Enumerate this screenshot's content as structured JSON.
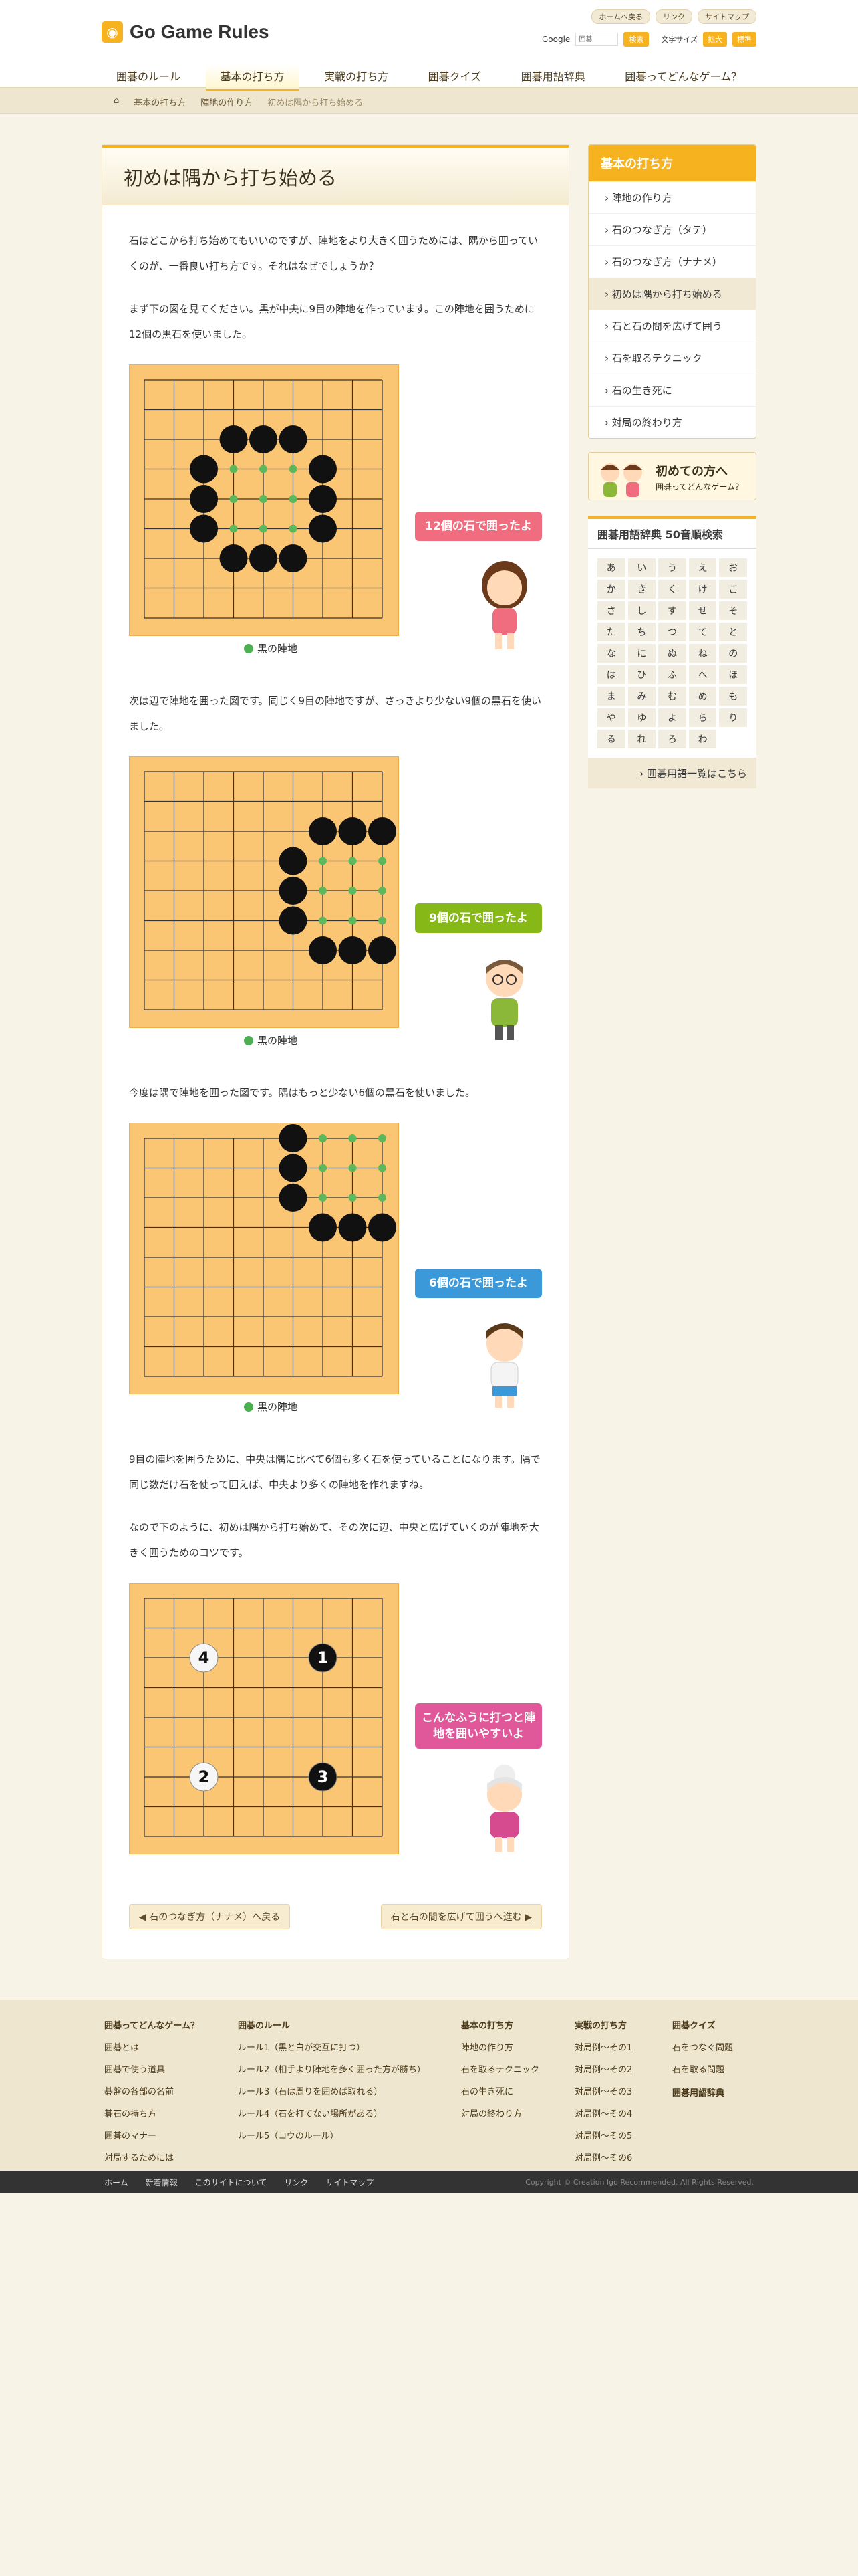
{
  "header": {
    "logo_text": "Go Game Rules",
    "util": [
      "ホームへ戻る",
      "リンク",
      "サイトマップ"
    ],
    "search_label": "Google",
    "search_placeholder": "囲碁",
    "search_button": "検索",
    "font_size_label": "文字サイズ",
    "font_large": "拡大",
    "font_std": "標準"
  },
  "nav": [
    "囲碁のルール",
    "基本の打ち方",
    "実戦の打ち方",
    "囲碁クイズ",
    "囲碁用語辞典",
    "囲碁ってどんなゲーム？"
  ],
  "breadcrumb": [
    "基本の打ち方",
    "陣地の作り方",
    "初めは隅から打ち始める"
  ],
  "main": {
    "title": "初めは隅から打ち始める",
    "p1": "石はどこから打ち始めてもいいのですが、陣地をより大きく囲うためには、隅から囲っていくのが、一番良い打ち方です。それはなぜでしょうか？",
    "p2": "まず下の図を見てください。黒が中央に9目の陣地を作っています。この陣地を囲うために12個の黒石を使いました。",
    "caption": "黒の陣地",
    "bubble1": "12個の石で囲ったよ",
    "p3": "次は辺で陣地を囲った図です。同じく9目の陣地ですが、さっきより少ない9個の黒石を使いました。",
    "bubble2": "9個の石で囲ったよ",
    "p4": "今度は隅で陣地を囲った図です。隅はもっと少ない6個の黒石を使いました。",
    "bubble3": "6個の石で囲ったよ",
    "p5": "9目の陣地を囲うために、中央は隅に比べて6個も多く石を使っていることになります。隅で同じ数だけ石を使って囲えば、中央より多くの陣地を作れますね。",
    "p6": "なので下のように、初めは隅から打ち始めて、その次に辺、中央と広げていくのが陣地を大きく囲うためのコツです。",
    "bubble4": "こんなふうに打つと陣地を囲いやすいよ",
    "prev": "石のつなぎ方（ナナメ）へ戻る",
    "next": "石と石の間を広げて囲うへ進む"
  },
  "sidebar": {
    "head": "基本の打ち方",
    "items": [
      "陣地の作り方",
      "石のつなぎ方（タテ）",
      "石のつなぎ方（ナナメ）",
      "初めは隅から打ち始める",
      "石と石の間を広げて囲う",
      "石を取るテクニック",
      "石の生き死に",
      "対局の終わり方"
    ],
    "promo1": "初めての方へ",
    "promo2": "囲碁ってどんなゲーム？",
    "dict_head": "囲碁用語辞典 50音順検索",
    "dict": [
      "あ",
      "い",
      "う",
      "え",
      "お",
      "か",
      "き",
      "く",
      "け",
      "こ",
      "さ",
      "し",
      "す",
      "せ",
      "そ",
      "た",
      "ち",
      "つ",
      "て",
      "と",
      "な",
      "に",
      "ぬ",
      "ね",
      "の",
      "は",
      "ひ",
      "ふ",
      "へ",
      "ほ",
      "ま",
      "み",
      "む",
      "め",
      "も",
      "や",
      "ゆ",
      "よ",
      "ら",
      "り",
      "る",
      "れ",
      "ろ",
      "わ"
    ],
    "dict_link": "囲碁用語一覧はこちら"
  },
  "footer": {
    "cols": [
      {
        "h": "囲碁ってどんなゲーム？",
        "items": [
          "囲碁とは",
          "囲碁で使う道具",
          "碁盤の各部の名前",
          "碁石の持ち方",
          "囲碁のマナー",
          "対局するためには"
        ]
      },
      {
        "h": "囲碁のルール",
        "items": [
          "ルール1（黒と白が交互に打つ）",
          "ルール2（相手より陣地を多く囲った方が勝ち）",
          "ルール3（石は周りを囲めば取れる）",
          "ルール4（石を打てない場所がある）",
          "ルール5（コウのルール）"
        ]
      },
      {
        "h": "基本の打ち方",
        "items": [
          "陣地の作り方",
          "石を取るテクニック",
          "石の生き死に",
          "対局の終わり方"
        ]
      },
      {
        "h": "実戦の打ち方",
        "items": [
          "対局例〜その1",
          "対局例〜その2",
          "対局例〜その3",
          "対局例〜その4",
          "対局例〜その5",
          "対局例〜その6"
        ]
      },
      {
        "h": "囲碁クイズ",
        "items": [
          "石をつなぐ問題",
          "石を取る問題"
        ]
      },
      {
        "h": "囲碁用語辞典",
        "items": []
      }
    ],
    "bottom_links": [
      "ホーム",
      "新着情報",
      "このサイトについて",
      "リンク",
      "サイトマップ"
    ],
    "copyright": "Copyright © Creation Igo Recommended. All Rights Reserved."
  }
}
